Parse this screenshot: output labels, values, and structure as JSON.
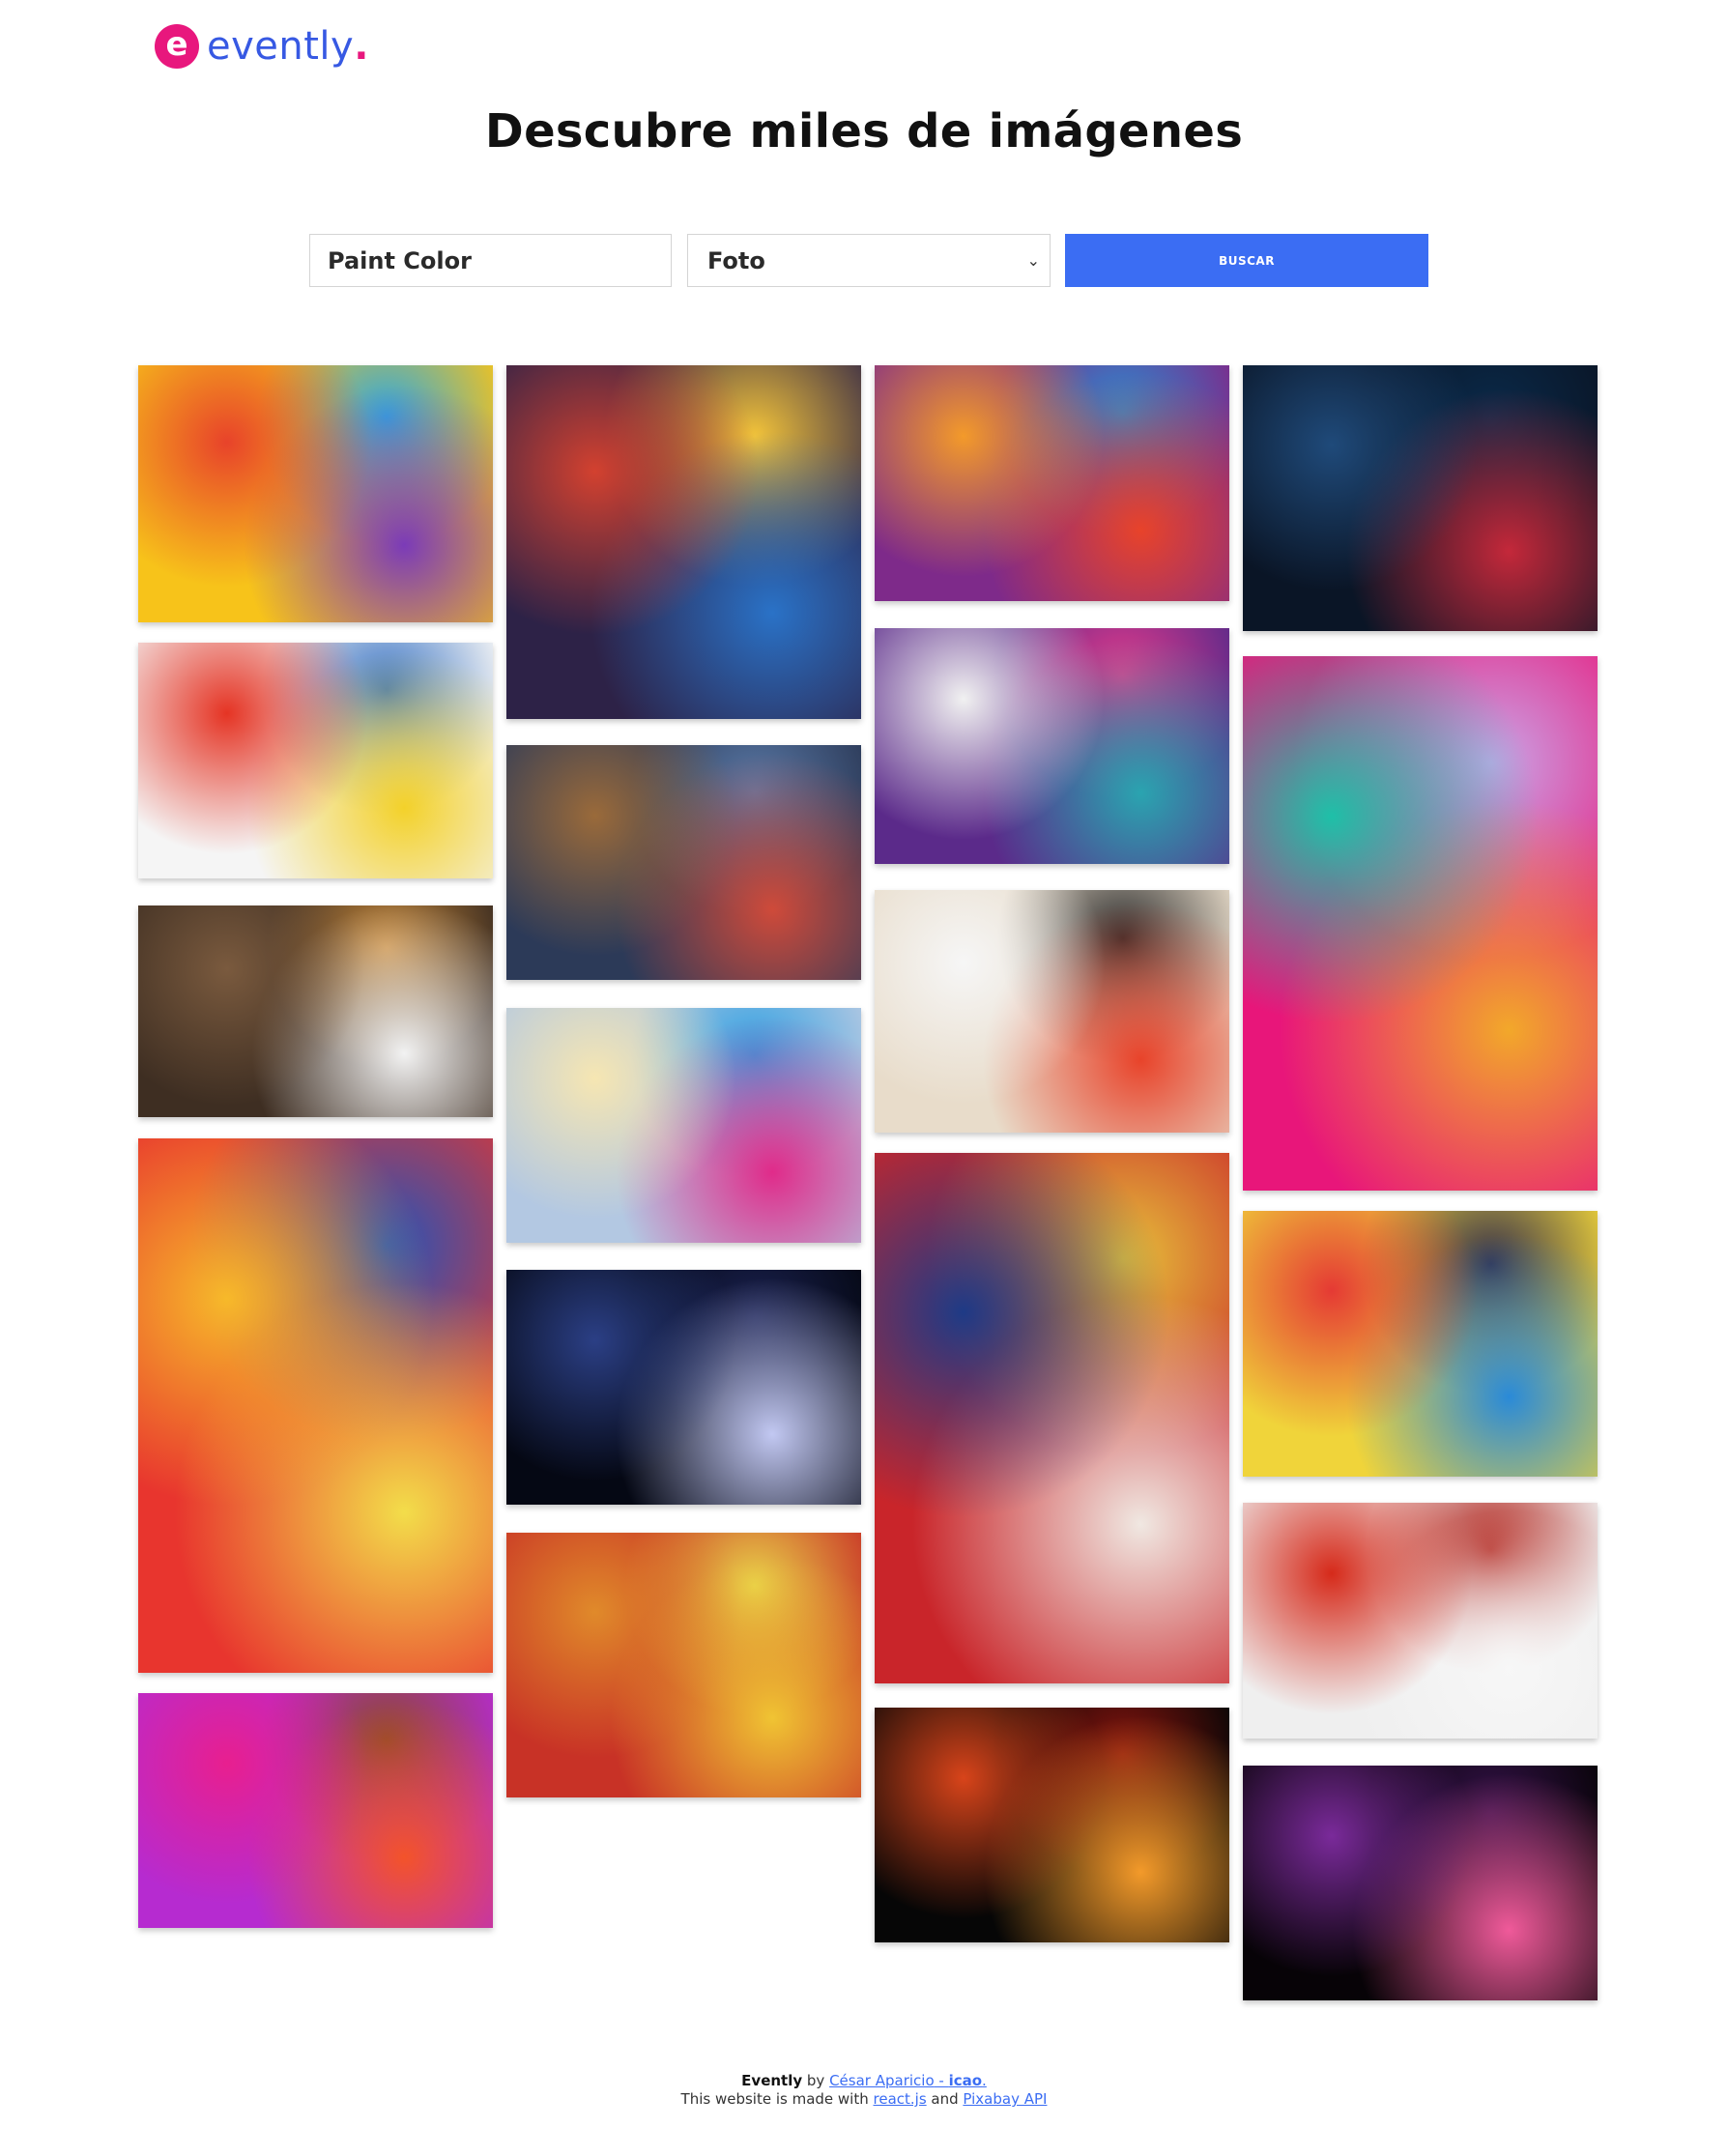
{
  "brand": {
    "mark": "e",
    "name": "evently",
    "dot": "."
  },
  "page": {
    "title": "Descubre miles de imágenes"
  },
  "search": {
    "value": "Paint Color"
  },
  "filter": {
    "selected": "Foto"
  },
  "buttons": {
    "search_label": "BUSCAR"
  },
  "gallery": {
    "images": [
      {
        "colors": [
          "#f7c31a",
          "#e8432a",
          "#7b3bb8",
          "#2fa8e0"
        ]
      },
      {
        "colors": [
          "#f5f5f5",
          "#e53424",
          "#f3d12a",
          "#3a74c4"
        ]
      },
      {
        "colors": [
          "#3e2e22",
          "#7a5a3e",
          "#f2f2f2",
          "#c98a3a"
        ]
      },
      {
        "colors": [
          "#e8352e",
          "#f7b92a",
          "#f3dd4a",
          "#2653b8"
        ]
      },
      {
        "colors": [
          "#b62bd0",
          "#e81f8f",
          "#f3532a",
          "#8a4a2a"
        ]
      },
      {
        "colors": [
          "#2d2247",
          "#d3412f",
          "#2a72c7",
          "#f2c33a"
        ]
      },
      {
        "colors": [
          "#2c3a58",
          "#9a6a3a",
          "#cf4a3a",
          "#5a7aa8"
        ]
      },
      {
        "colors": [
          "#b3c8e2",
          "#f6e6b2",
          "#e02b8a",
          "#2fa0e2"
        ]
      },
      {
        "colors": [
          "#050814",
          "#2b3f85",
          "#c2c8f2",
          "#1a2150"
        ]
      },
      {
        "colors": [
          "#c83226",
          "#e08a2a",
          "#f0c433",
          "#e9d34a"
        ]
      },
      {
        "colors": [
          "#7e2a8a",
          "#f39a2a",
          "#e8432a",
          "#2a8ad0"
        ]
      },
      {
        "colors": [
          "#5b2a8a",
          "#f1f1f1",
          "#2aa4b0",
          "#e53a8a"
        ]
      },
      {
        "colors": [
          "#e8dcca",
          "#f6f6f6",
          "#e8432a",
          "#2c2c2c"
        ]
      },
      {
        "colors": [
          "#c9252a",
          "#1e3a86",
          "#f0e8e2",
          "#e6c23a"
        ]
      },
      {
        "colors": [
          "#060606",
          "#d8441a",
          "#f39a2a",
          "#8a140e"
        ]
      },
      {
        "colors": [
          "#0a1526",
          "#1f4a7a",
          "#c4283a",
          "#0a2a4a"
        ]
      },
      {
        "colors": [
          "#e8167a",
          "#1ec0a8",
          "#f2a82a",
          "#c9a6e8"
        ]
      },
      {
        "colors": [
          "#f0d43a",
          "#e53a34",
          "#2a8ad8",
          "#35304a"
        ]
      },
      {
        "colors": [
          "#efefef",
          "#d62a1a",
          "#f7f7f7",
          "#b01e16"
        ]
      },
      {
        "colors": [
          "#070307",
          "#7a2a9a",
          "#f05a9a",
          "#35124a"
        ]
      }
    ]
  },
  "footer": {
    "brand": "Evently",
    "by": " by ",
    "author": "César Aparicio",
    "sep": " - ",
    "handle": "icao",
    "end": ".",
    "made_with": "This website is made with ",
    "lib": "react.js",
    "and": " and ",
    "api": "Pixabay API"
  }
}
